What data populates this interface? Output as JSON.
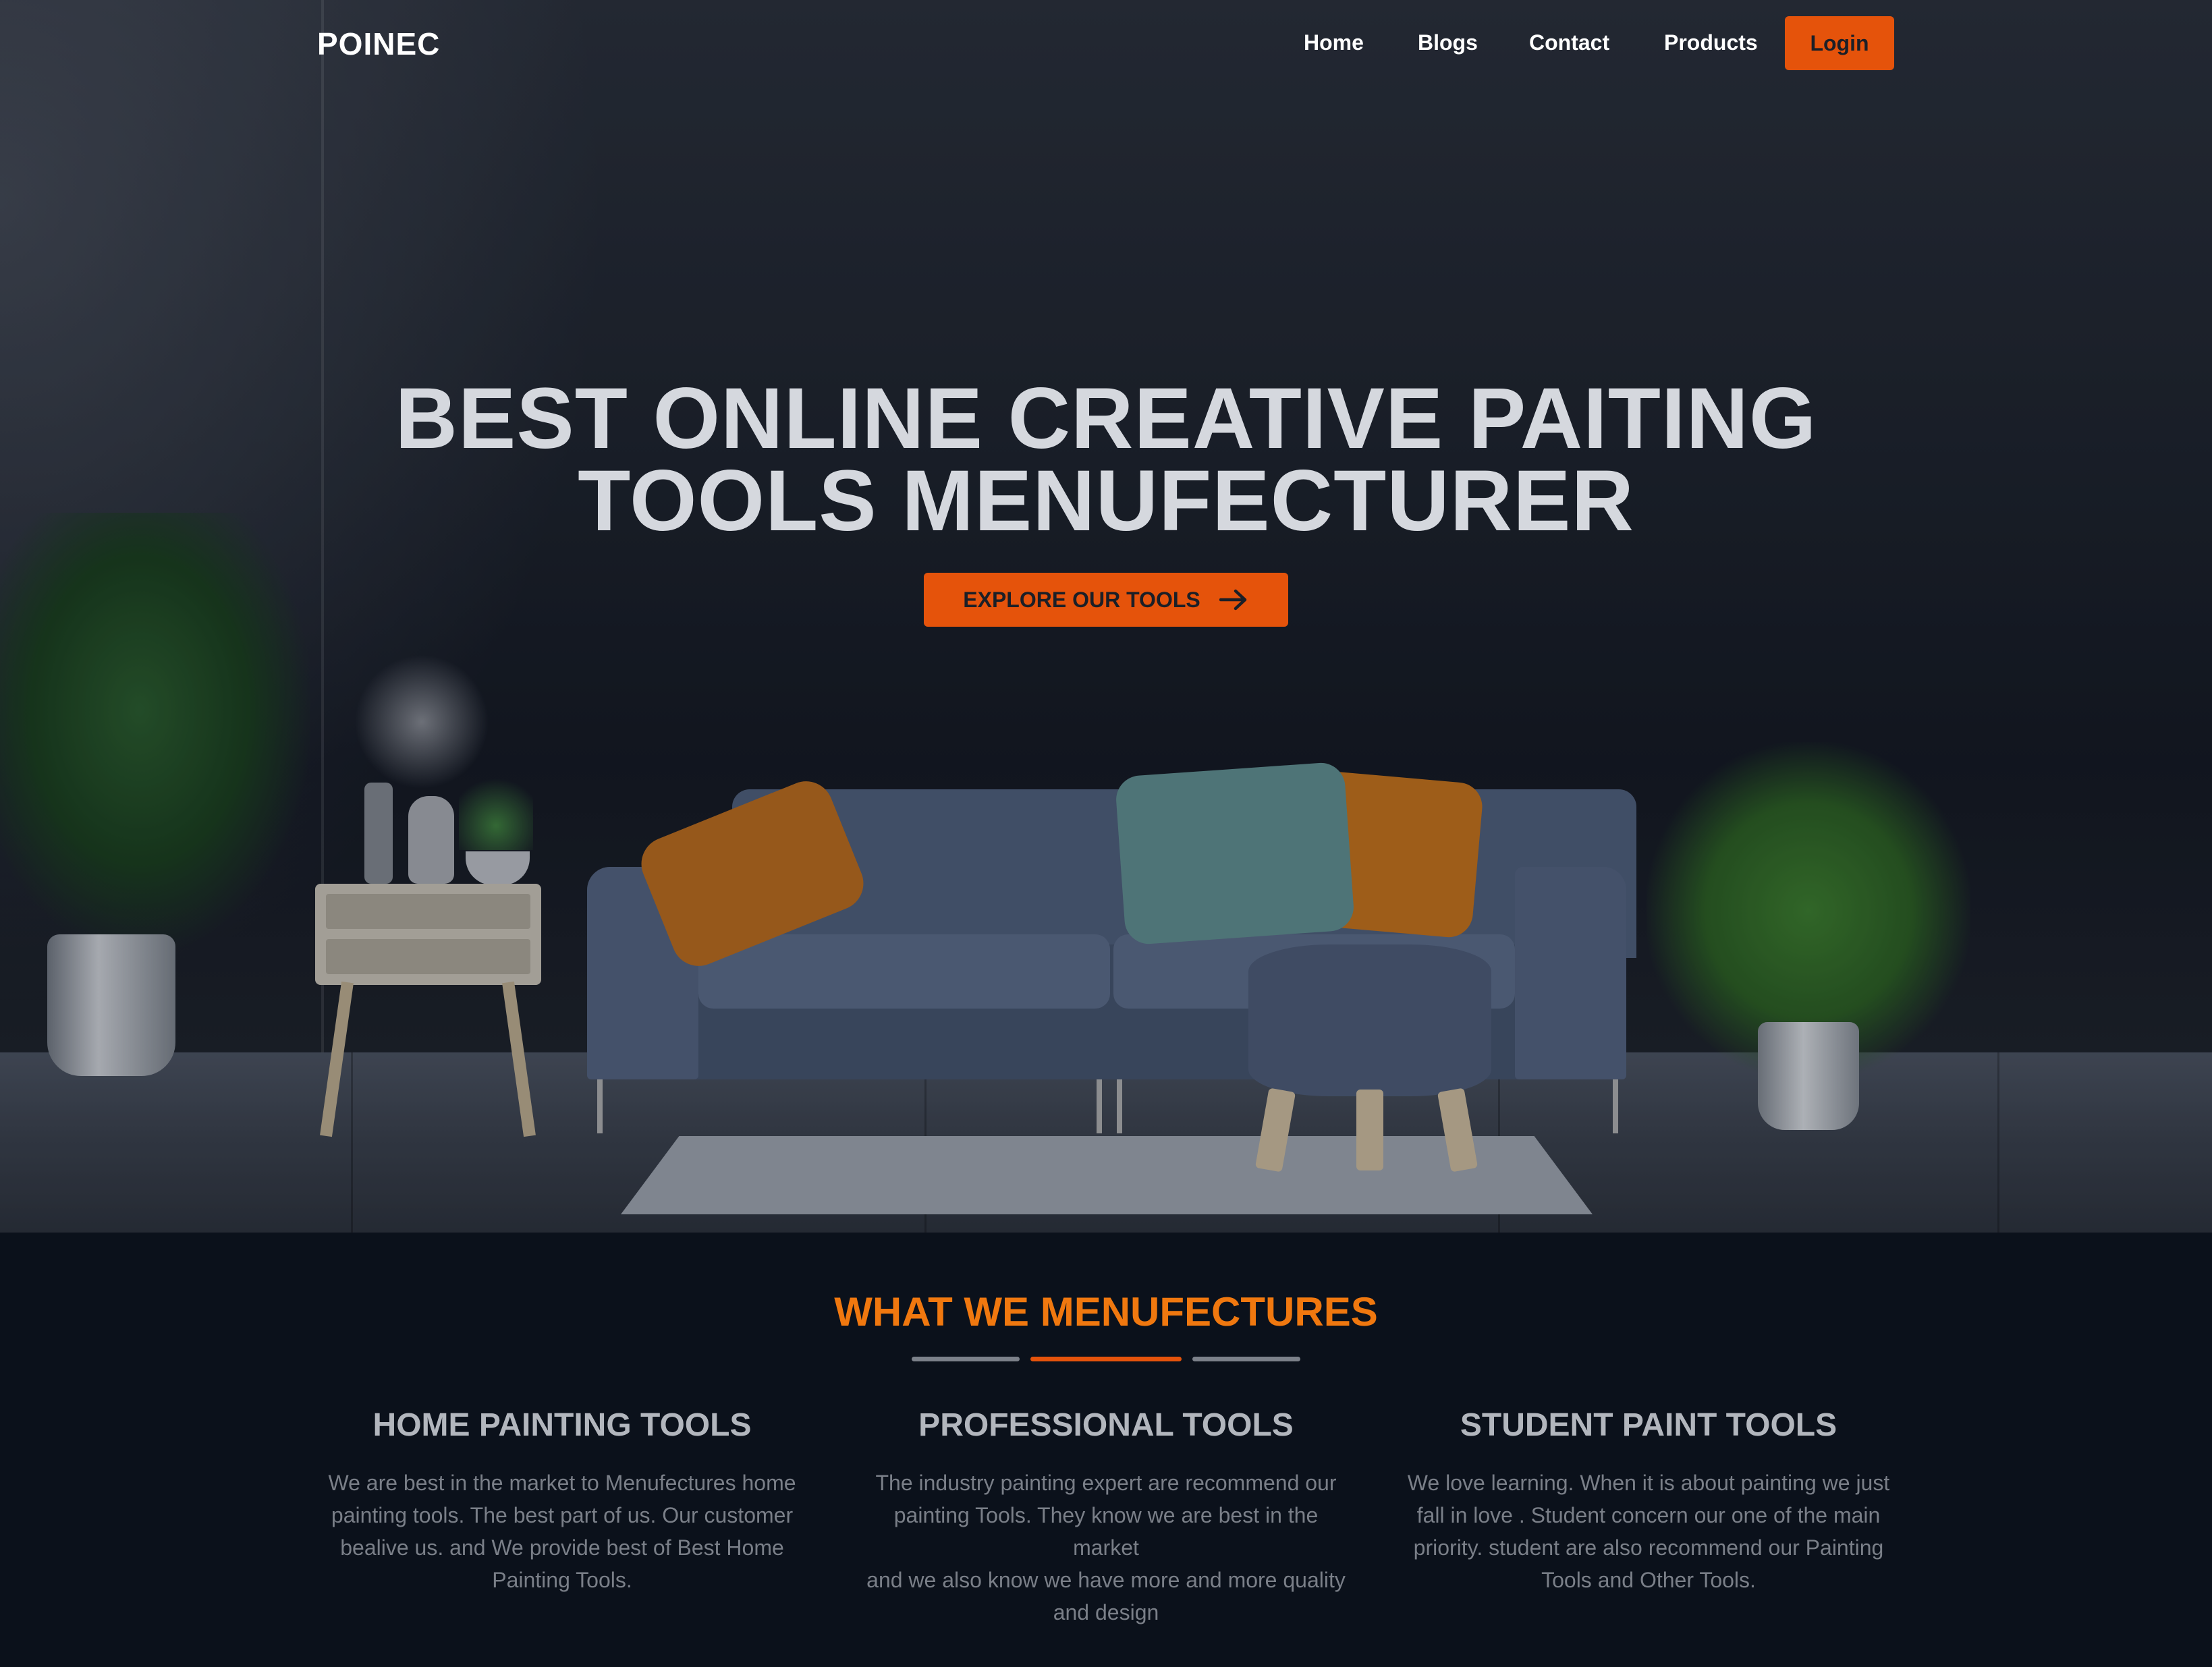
{
  "nav": {
    "logo": "POINEC",
    "links": [
      "Home",
      "Blogs",
      "Contact",
      "Products"
    ],
    "login_label": "Login"
  },
  "hero": {
    "title_line1": "BEST ONLINE CREATIVE PAITING",
    "title_line2": "TOOLS MENUFECTURER",
    "cta_label": "EXPLORE OUR TOOLS"
  },
  "services": {
    "title": "WHAT WE MENUFECTURES",
    "items": [
      {
        "title": "HOME PAINTING TOOLS",
        "lines": [
          "We are best in the market to Menufectures home",
          "painting tools. The best part of us. Our customer",
          "bealive us. and We provide best of Best Home",
          "Painting Tools."
        ]
      },
      {
        "title": "PROFESSIONAL TOOLS",
        "lines": [
          "The industry painting expert are recommend our",
          "painting Tools. They know we are best in the market",
          "and we also know we have more and more quality",
          "and design"
        ]
      },
      {
        "title": "STUDENT PAINT TOOLS",
        "lines": [
          "We love learning. When it is about painting we just",
          "fall in love . Student concern our one of the main",
          "priority. student are also recommend our Painting",
          "Tools and Other Tools."
        ]
      }
    ]
  },
  "colors": {
    "accent": "#e5530b",
    "heading_accent": "#f0780f",
    "background": "#0b111b"
  },
  "icons": {
    "cta_icon": "arrow-right-icon"
  }
}
